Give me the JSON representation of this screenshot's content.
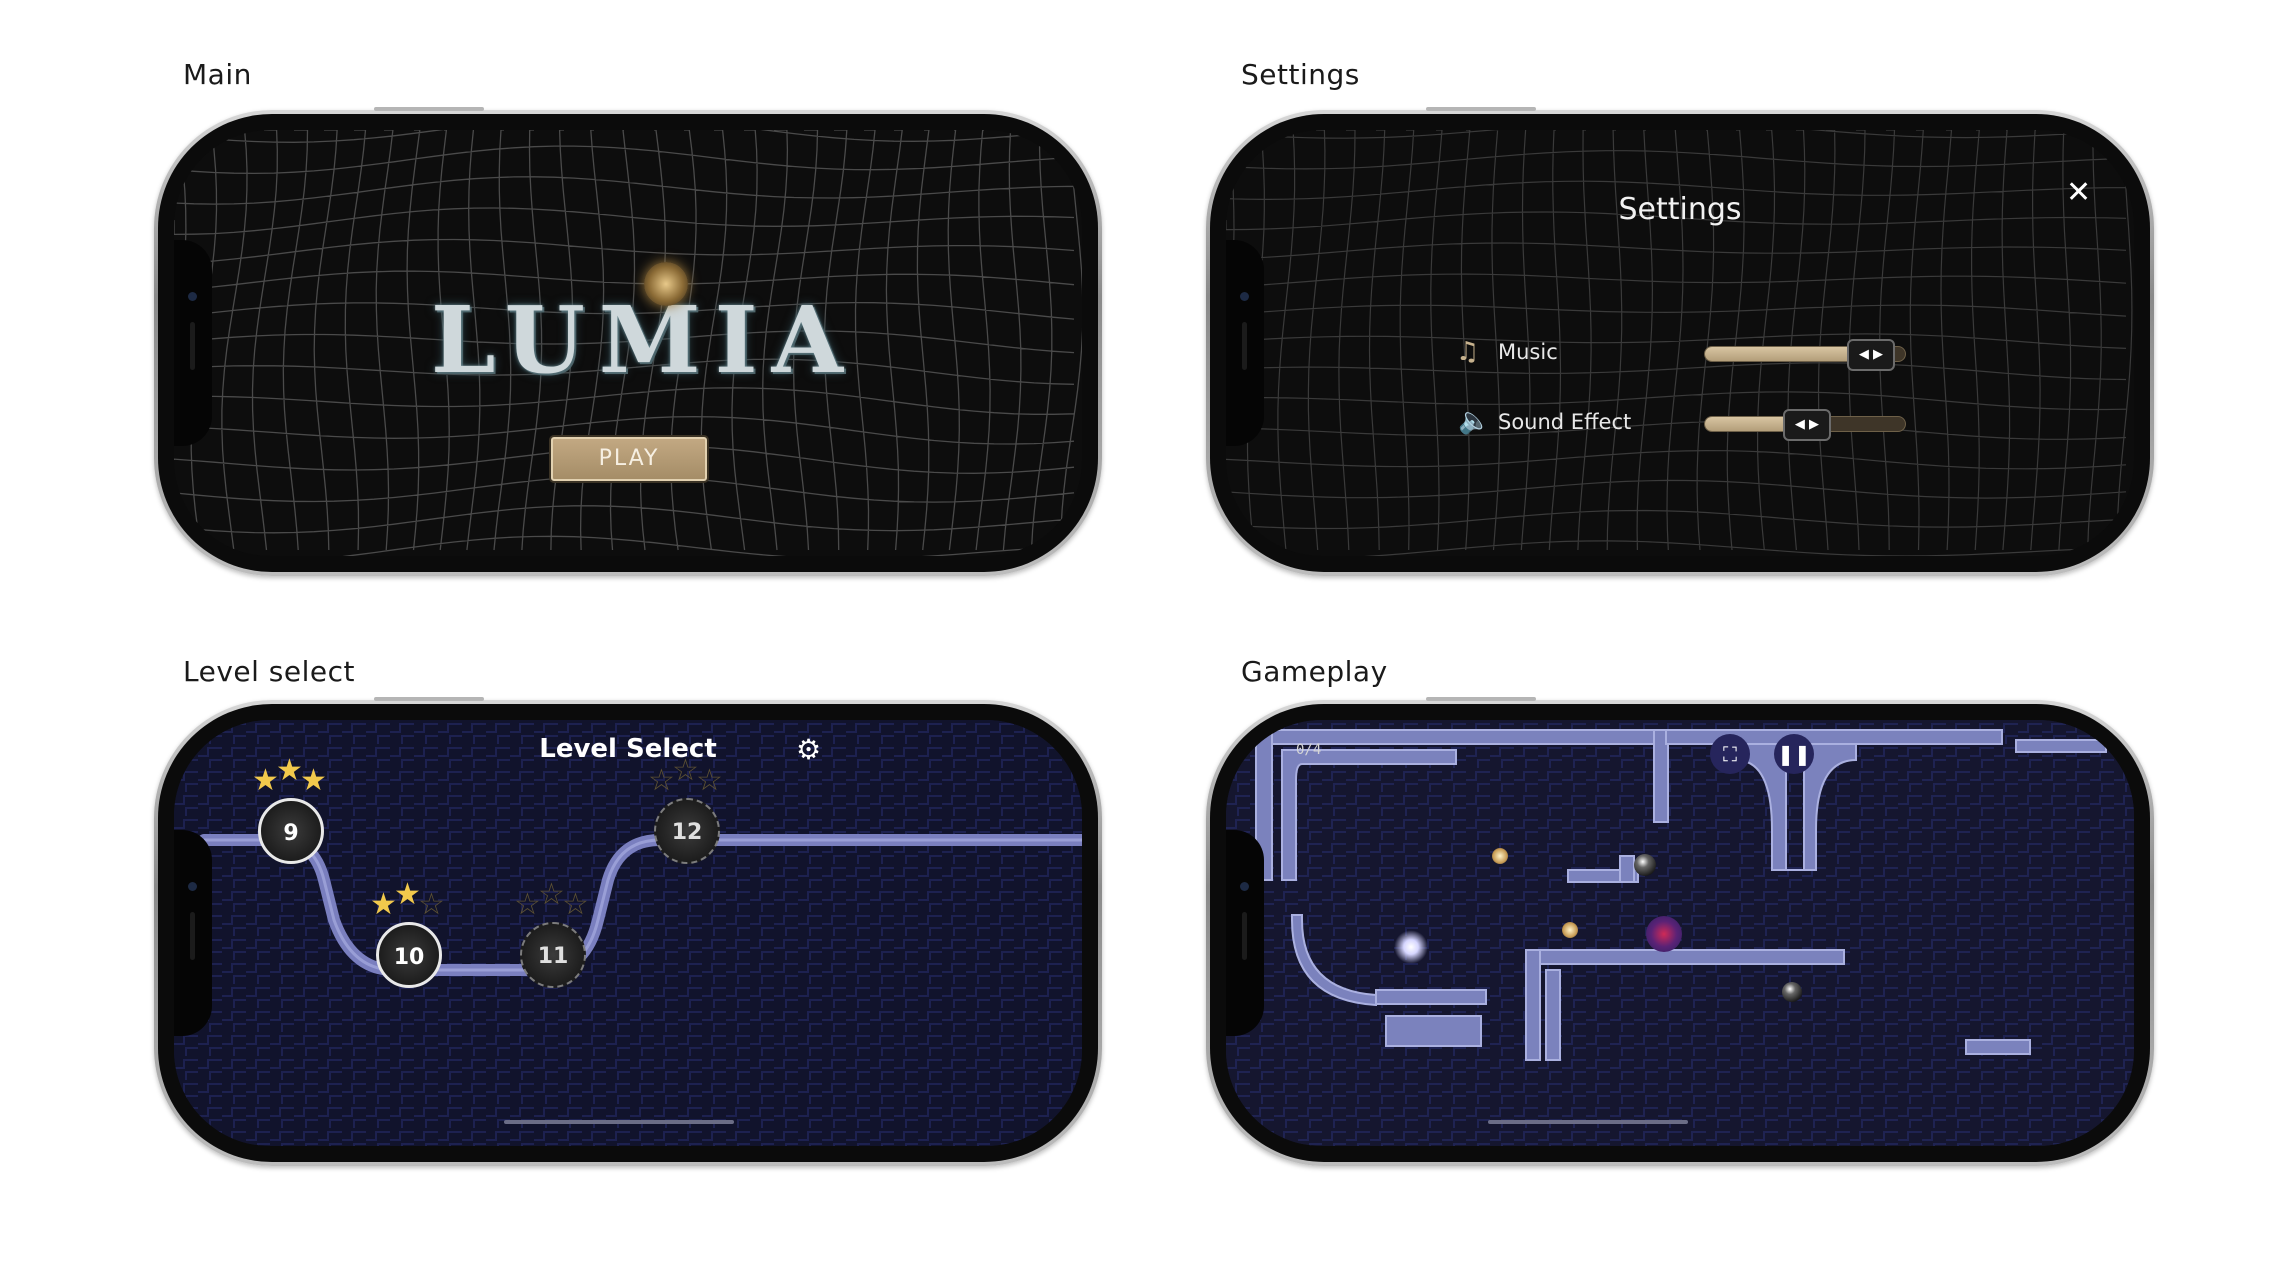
{
  "panels": {
    "main": {
      "label": "Main",
      "logo_text": "LUMIA",
      "play_label": "PLAY"
    },
    "settings": {
      "label": "Settings",
      "title": "Settings",
      "close_icon": "close-icon",
      "rows": [
        {
          "icon": "music-note-icon",
          "label": "Music",
          "value_pct": 82
        },
        {
          "icon": "speaker-icon",
          "label": "Sound Effect",
          "value_pct": 50
        }
      ]
    },
    "level_select": {
      "label": "Level select",
      "title": "Level Select",
      "settings_icon": "gear-icon",
      "levels": [
        {
          "number": "9",
          "stars": 3,
          "locked": false
        },
        {
          "number": "10",
          "stars": 2,
          "locked": false
        },
        {
          "number": "11",
          "stars": 0,
          "locked": true
        },
        {
          "number": "12",
          "stars": 0,
          "locked": true
        }
      ]
    },
    "gameplay": {
      "label": "Gameplay",
      "counter": "0/4",
      "fullscreen_icon": "fullscreen-icon",
      "pause_icon": "pause-icon"
    }
  },
  "colors": {
    "accent_gold": "#c2a882",
    "star_gold": "#f2c94c",
    "level_bg": "#11132c",
    "pipe": "#7c82c2"
  }
}
